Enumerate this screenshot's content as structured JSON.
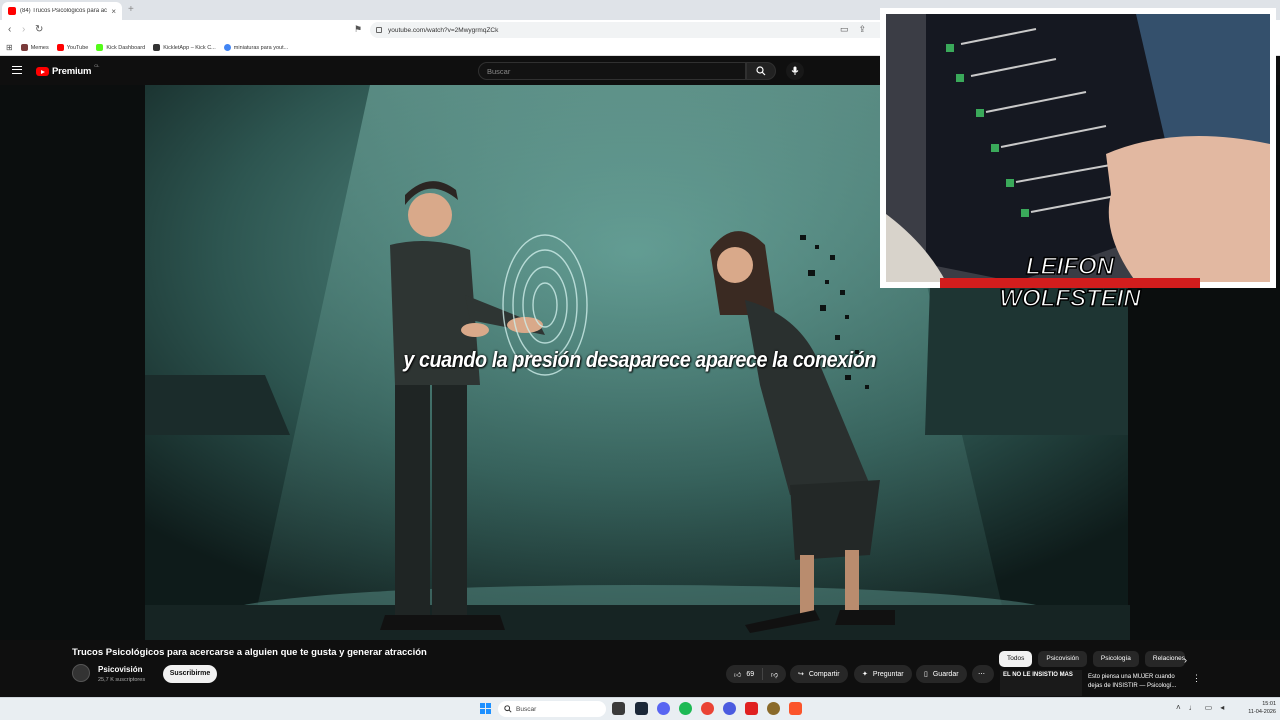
{
  "browser": {
    "tab_title": "(84) Trucos Psicológicos para ac",
    "tab_close": "×",
    "new_tab": "+",
    "url": "youtube.com/watch?v=2MwygrmqZCk",
    "bookmarks": [
      {
        "label": "Memes",
        "color": "#7a3b3b"
      },
      {
        "label": "YouTube",
        "color": "#ff0000"
      },
      {
        "label": "Kick Dashboard",
        "color": "#53fc18"
      },
      {
        "label": "KickletApp – Kick C...",
        "color": "#333333"
      },
      {
        "label": "miniaturas para yout...",
        "color": "#4285f4"
      }
    ]
  },
  "youtube": {
    "logo_text": "Premium",
    "country_code": "CL",
    "search_placeholder": "Buscar"
  },
  "video": {
    "caption": "y cuando la presión desaparece aparece la conexión",
    "webcam_overlay_text": [
      "LEIFON",
      "WOLFSTEIN"
    ]
  },
  "meta": {
    "title": "Trucos Psicológicos para acercarse a alguien que te gusta y generar atracción",
    "channel": "Psicovisión",
    "subscribers": "25,7 K suscriptores",
    "subscribe_label": "Suscribirme",
    "likes": "69",
    "share_label": "Compartir",
    "ask_label": "Preguntar",
    "save_label": "Guardar"
  },
  "chips": [
    "Todos",
    "Psicovisión",
    "Psicología",
    "Relaciones"
  ],
  "recommendation": {
    "thumb_text": "EL NO LE INSISTIO MAS",
    "title": "Esto piensa una MUJER cuando dejas de INSISTIR — Psicologí..."
  },
  "taskbar": {
    "search_placeholder": "Buscar",
    "time": "15:01",
    "date": "11-04-2026"
  },
  "colors": {
    "youtube_red": "#ff0000",
    "background": "#0f0f0f",
    "stage_teal": "#4f8a80"
  }
}
